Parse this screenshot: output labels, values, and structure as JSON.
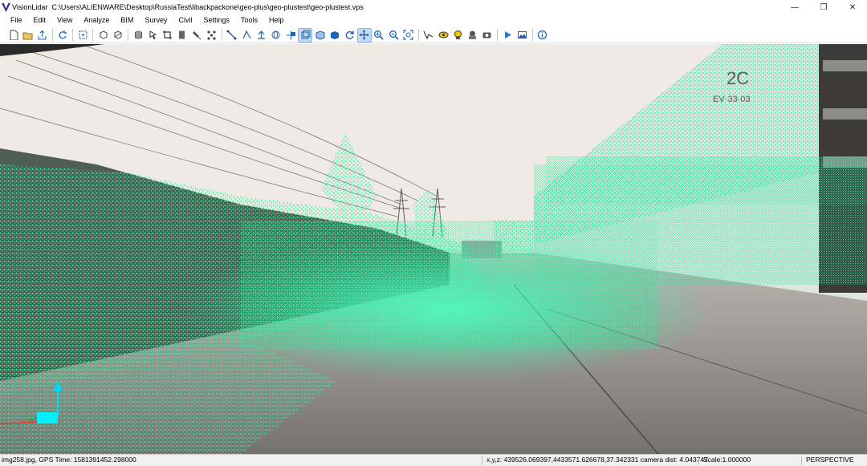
{
  "window": {
    "app_name": "VisionLidar",
    "file_path": "C:\\Users\\ALIENWARE\\Desktop\\RussiaTest\\libackpackone\\geo-plus\\geo-plustest\\geo-plustest.vps",
    "controls": {
      "minimize": "—",
      "restore": "❐",
      "close": "✕"
    }
  },
  "menu": [
    "File",
    "Edit",
    "View",
    "Analyze",
    "BIM",
    "Survey",
    "Civil",
    "Settings",
    "Tools",
    "Help"
  ],
  "toolbar": {
    "groups": [
      [
        {
          "icon": "new-file-icon"
        },
        {
          "icon": "open-folder-icon"
        },
        {
          "icon": "export-icon"
        }
      ],
      [
        {
          "icon": "refresh-icon"
        }
      ],
      [
        {
          "icon": "select-points-icon"
        }
      ],
      [
        {
          "icon": "cube-outline-icon"
        },
        {
          "icon": "cube-cut-icon"
        }
      ],
      [
        {
          "icon": "database-icon"
        },
        {
          "icon": "pointer-icon"
        },
        {
          "icon": "crop-icon"
        },
        {
          "icon": "document-icon"
        },
        {
          "icon": "brush-icon"
        },
        {
          "icon": "cluster-icon"
        }
      ],
      [
        {
          "icon": "measure-line-icon"
        },
        {
          "icon": "measure-angle-icon"
        },
        {
          "icon": "measure-tree-icon"
        },
        {
          "icon": "globe-icon"
        },
        {
          "icon": "move-icon"
        },
        {
          "icon": "view-front-icon",
          "active": true
        },
        {
          "icon": "view-iso-icon"
        },
        {
          "icon": "view-solid-icon"
        },
        {
          "icon": "rotate-icon"
        },
        {
          "icon": "pan-icon",
          "active": true
        },
        {
          "icon": "zoom-in-icon"
        },
        {
          "icon": "zoom-out-icon"
        },
        {
          "icon": "zoom-fit-icon"
        }
      ],
      [
        {
          "icon": "camera-path-icon"
        },
        {
          "icon": "eye-icon"
        },
        {
          "icon": "view-lock-icon"
        },
        {
          "icon": "image-view-icon"
        },
        {
          "icon": "camera-icon"
        }
      ],
      [
        {
          "icon": "play-icon"
        },
        {
          "icon": "photo-icon"
        }
      ],
      [
        {
          "icon": "info-icon"
        }
      ]
    ]
  },
  "scene": {
    "building_sign_number": "2C",
    "building_sign_text": "EV·33·03",
    "sky_color": "#f1ede6",
    "point_color": "#2ef5a8",
    "ground_color": "#8a8781"
  },
  "status": {
    "left": "img258.jpg, GPS Time: 1581391452.298000",
    "coords": "x,y,z: 439526.069397,4433571.626678,37.342331  camera dist: 4.043747",
    "scale": "Scale:1.000000",
    "projection": "PERSPECTIVE"
  }
}
